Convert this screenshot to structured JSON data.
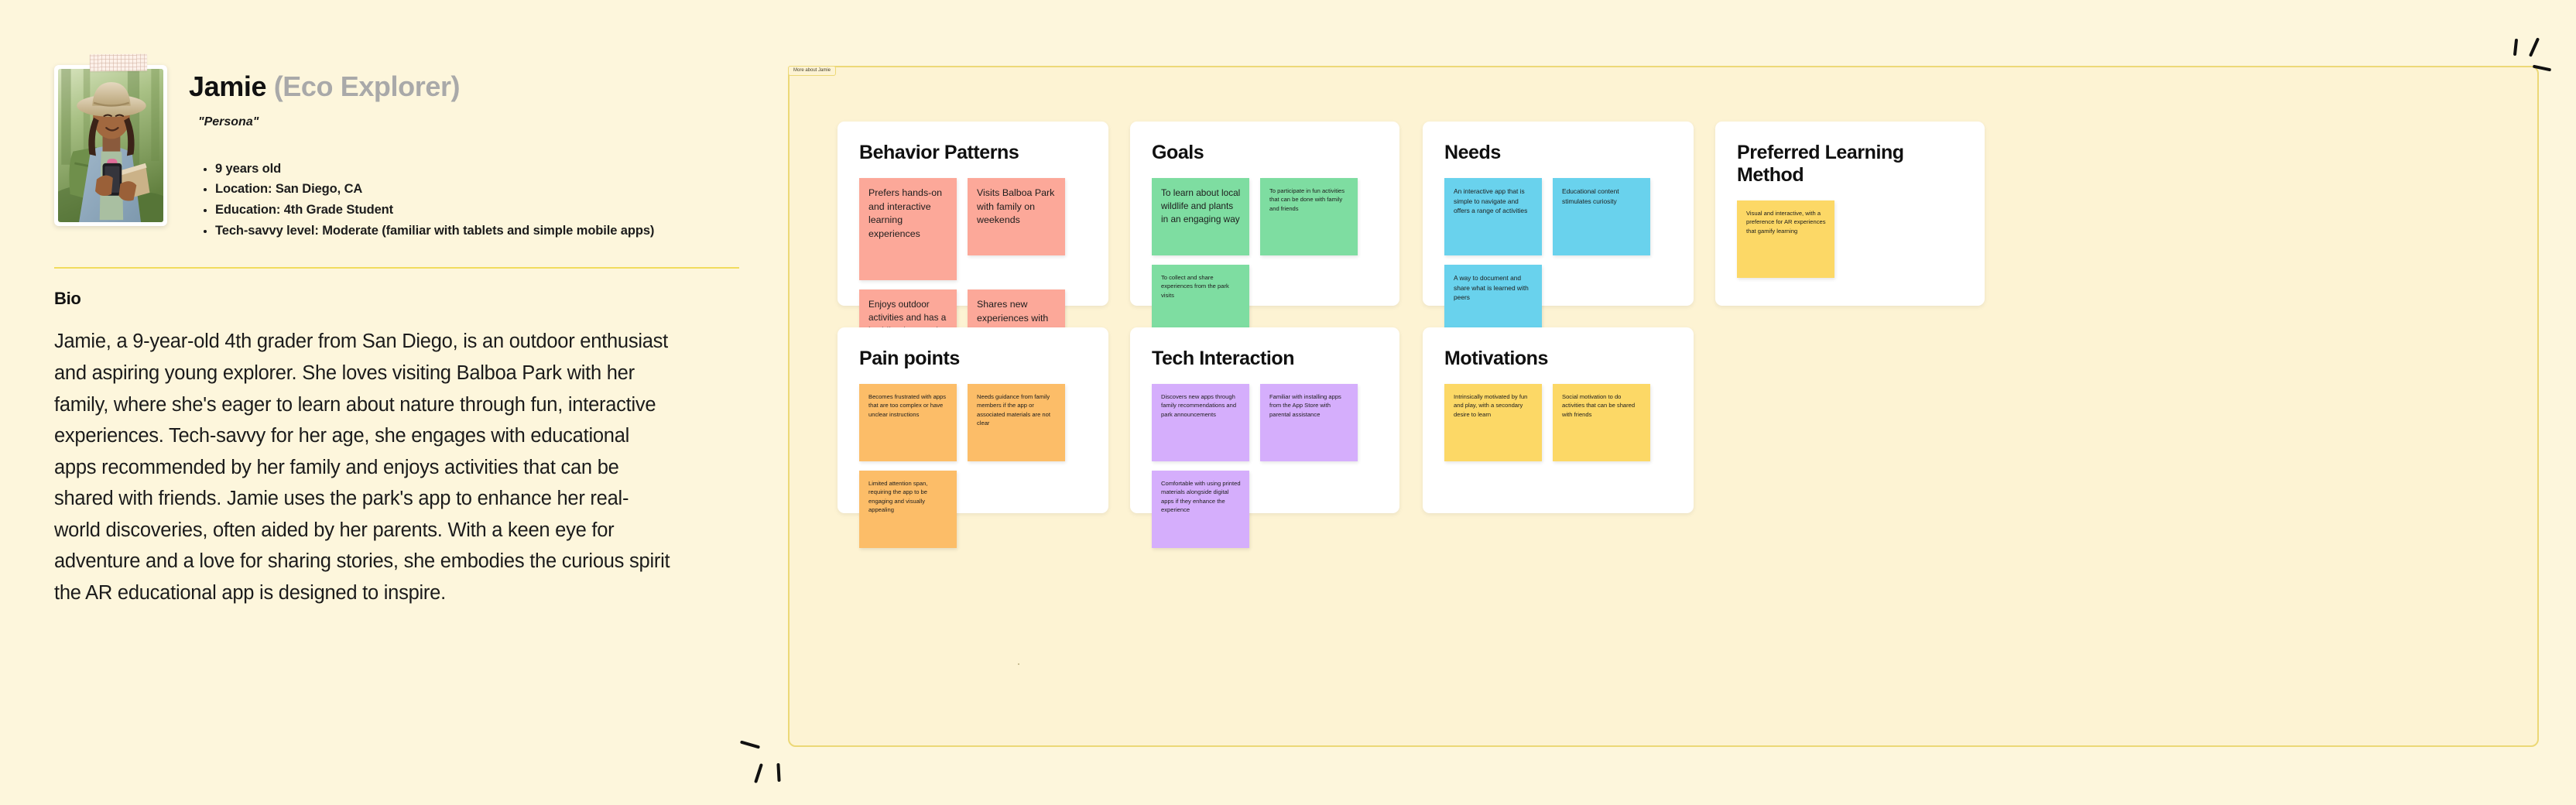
{
  "persona": {
    "name": "Jamie",
    "role": "(Eco Explorer)",
    "tag": "\"Persona\"",
    "photo_alt": "girl-in-hat-reading-phone-photo",
    "facts": [
      "9 years old",
      "Location: San Diego, CA",
      "Education: 4th Grade Student",
      "Tech-savvy level: Moderate (familiar with tablets and simple mobile apps)"
    ],
    "bio_heading": "Bio",
    "bio": "Jamie, a 9-year-old 4th grader from San Diego, is an outdoor enthusiast and aspiring young explorer. She loves visiting Balboa Park with her family, where she's eager to learn about nature through fun, interactive experiences. Tech-savvy for her age, she engages with educational apps recommended by her family and enjoys activities that can be shared with friends. Jamie uses the park's app to enhance her real-world discoveries, often aided by her parents. With a keen eye for adventure and a love for sharing stories, she embodies the curious spirit the AR educational app is designed to inspire."
  },
  "board": {
    "label": "More about Jamie",
    "colors": {
      "background": "#fdf3d3",
      "border": "#ecd877",
      "page_background": "#fdf6dc",
      "note_pink": "#fca899",
      "note_green": "#7edda1",
      "note_blue": "#69d2ed",
      "note_orange": "#fcbd68",
      "note_purple": "#d5aefc",
      "note_yellow": "#fcd866",
      "highlight_yellow": "#fbef7a",
      "divider": "#f1dc5e"
    },
    "panels": [
      {
        "id": "behavior",
        "title": "Behavior Patterns",
        "color": "#fca899",
        "notes": [
          {
            "text": "Prefers hands-on and interactive learning experiences",
            "size": "lg",
            "tall": true
          },
          {
            "text": "Visits Balboa Park with family on weekends",
            "size": "lg",
            "tall": false
          },
          {
            "text": "Enjoys outdoor activities and has a budding interest in nature and wildlife",
            "size": "md",
            "tall": false
          },
          {
            "text": "Shares new experiences with friends",
            "size": "lg",
            "tall": true
          }
        ]
      },
      {
        "id": "goals",
        "title": "Goals",
        "color": "#7edda1",
        "notes": [
          {
            "text": "To learn about local wildlife and plants in an engaging way",
            "size": "md",
            "tall": false
          },
          {
            "text": "To participate in fun activities that can be done with family and friends",
            "size": "sm",
            "tall": false
          },
          {
            "text": "To collect and share experiences from the park visits",
            "size": "sm",
            "tall": false
          }
        ]
      },
      {
        "id": "needs",
        "title": "Needs",
        "color": "#69d2ed",
        "notes": [
          {
            "text": "An interactive app that is simple to navigate and offers a range of activities",
            "size": "xs",
            "tall": false
          },
          {
            "text": "Educational content stimulates curiosity",
            "size": "xs",
            "tall": false
          },
          {
            "text": "A way to document and share what is learned with peers",
            "size": "xs",
            "tall": false
          }
        ]
      },
      {
        "id": "learning",
        "title": "Preferred Learning Method",
        "color": "#fcd866",
        "notes": [
          {
            "text": "Visual and interactive, with a preference for AR experiences that gamify learning",
            "size": "sm",
            "tall": false
          }
        ]
      },
      {
        "id": "pain",
        "title": "Pain points",
        "color": "#fcbd68",
        "notes": [
          {
            "text": "Becomes frustrated with apps that are too complex or have unclear instructions",
            "size": "sm",
            "tall": false
          },
          {
            "text": "Needs guidance from family members if the app or associated materials are not clear",
            "size": "sm",
            "tall": false
          },
          {
            "text": "Limited attention span, requiring the app to be engaging and visually appealing",
            "size": "sm",
            "tall": false
          }
        ]
      },
      {
        "id": "tech",
        "title": "Tech Interaction",
        "color": "#d5aefc",
        "notes": [
          {
            "text": "Discovers new apps through family recommendations and park announcements",
            "size": "sm",
            "tall": false
          },
          {
            "text": "Familiar with installing apps from the App Store with parental assistance",
            "size": "sm",
            "tall": false
          },
          {
            "text": "Comfortable with using printed materials alongside digital apps if they enhance the experience",
            "size": "sm",
            "tall": false
          }
        ]
      },
      {
        "id": "motiv",
        "title": "Motivations",
        "color": "#fcd866",
        "notes": [
          {
            "text": "Intrinsically motivated by fun and play, with a secondary desire to learn",
            "size": "sm",
            "tall": false
          },
          {
            "text": "Social motivation to do activities that can be shared with friends",
            "size": "sm",
            "tall": false
          }
        ]
      }
    ]
  },
  "decorations": {
    "sparkle_top_right": "sparkle-icon",
    "sparkle_bottom_left": "sparkle-icon"
  }
}
